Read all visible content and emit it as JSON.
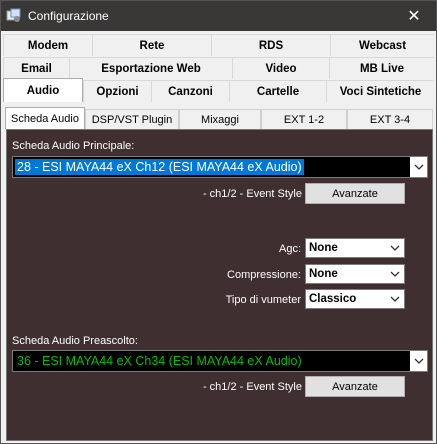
{
  "window": {
    "title": "Configurazione",
    "close": "✕"
  },
  "tabs_row1": [
    "Modem",
    "Rete",
    "RDS",
    "Webcast"
  ],
  "tabs_row2": [
    "Email",
    "Esportazione Web",
    "Video",
    "MB Live"
  ],
  "tabs_row3": [
    "Audio",
    "Opzioni",
    "Canzoni",
    "Cartelle",
    "Voci Sintetiche"
  ],
  "active_main_tab": "Audio",
  "subtabs": [
    "Scheda Audio",
    "DSP/VST Plugin",
    "Mixaggi",
    "EXT 1-2",
    "EXT 3-4"
  ],
  "active_subtab": "Scheda Audio",
  "main_card": {
    "label": "Scheda Audio Principale:",
    "selected": "28 - ESI MAYA44 eX Ch12 (ESI MAYA44 eX Audio)",
    "highlight_bg": "#0078d7",
    "highlight_fg": "#ffffff",
    "status": "- ch1/2 - Event Style",
    "advanced_button": "Avanzate"
  },
  "agc": {
    "label": "Agc:",
    "value": "None"
  },
  "compression": {
    "label": "Compressione:",
    "value": "None"
  },
  "vumeter": {
    "label": "Tipo di vumeter",
    "value": "Classico"
  },
  "preview_card": {
    "label": "Scheda Audio Preascolto:",
    "selected": "36 - ESI MAYA44 eX Ch34 (ESI MAYA44 eX Audio)",
    "text_color": "#00c000",
    "status": "- ch1/2 - Event Style",
    "advanced_button": "Avanzate"
  },
  "colors": {
    "titlebar": "#3a3737",
    "panel": "#3f2f31",
    "accent": "#0078d7"
  }
}
